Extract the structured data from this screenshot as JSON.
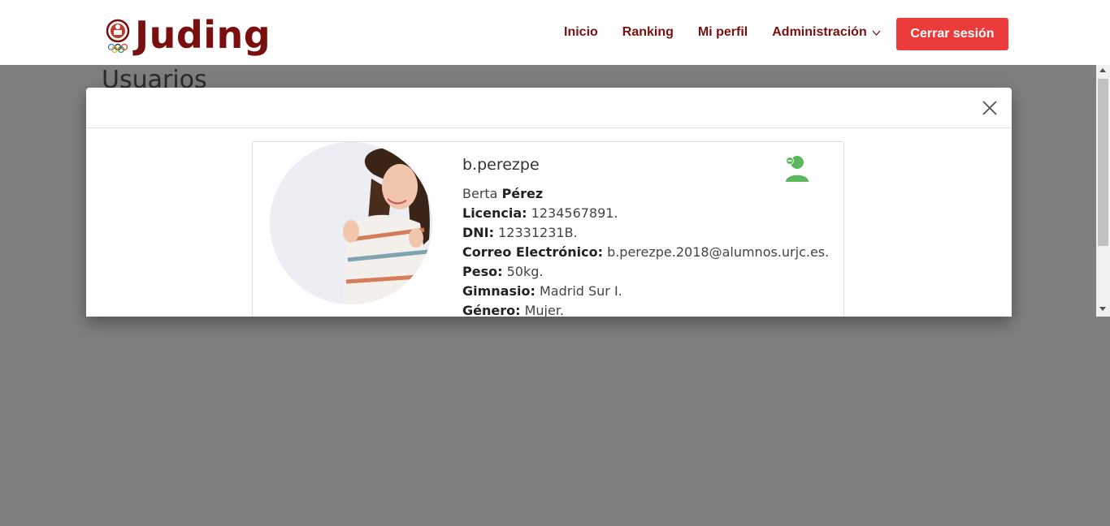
{
  "app": {
    "brand": "Juding",
    "colors": {
      "brand": "#7a0f0f",
      "danger": "#ec3b3b",
      "success": "#5cb85c"
    }
  },
  "nav": {
    "items": [
      {
        "label": "Inicio"
      },
      {
        "label": "Ranking"
      },
      {
        "label": "Mi perfil"
      }
    ],
    "admin_label": "Administración",
    "logout_label": "Cerrar sesión"
  },
  "page": {
    "title": "Usuarios"
  },
  "modal": {
    "close_icon": "close-icon",
    "user": {
      "username": "b.perezpe",
      "first_name": "Berta",
      "last_name": "Pérez",
      "fields": [
        {
          "label": "Licencia:",
          "value": "1234567891."
        },
        {
          "label": "DNI:",
          "value": "12331231B."
        },
        {
          "label": "Correo Electrónico:",
          "value": "b.perezpe.2018@alumnos.urjc.es."
        },
        {
          "label": "Peso:",
          "value": "50kg."
        },
        {
          "label": "Gimnasio:",
          "value": "Madrid Sur I."
        },
        {
          "label": "Género:",
          "value": "Mujer."
        }
      ],
      "action_icon": "user-remove-icon"
    }
  }
}
